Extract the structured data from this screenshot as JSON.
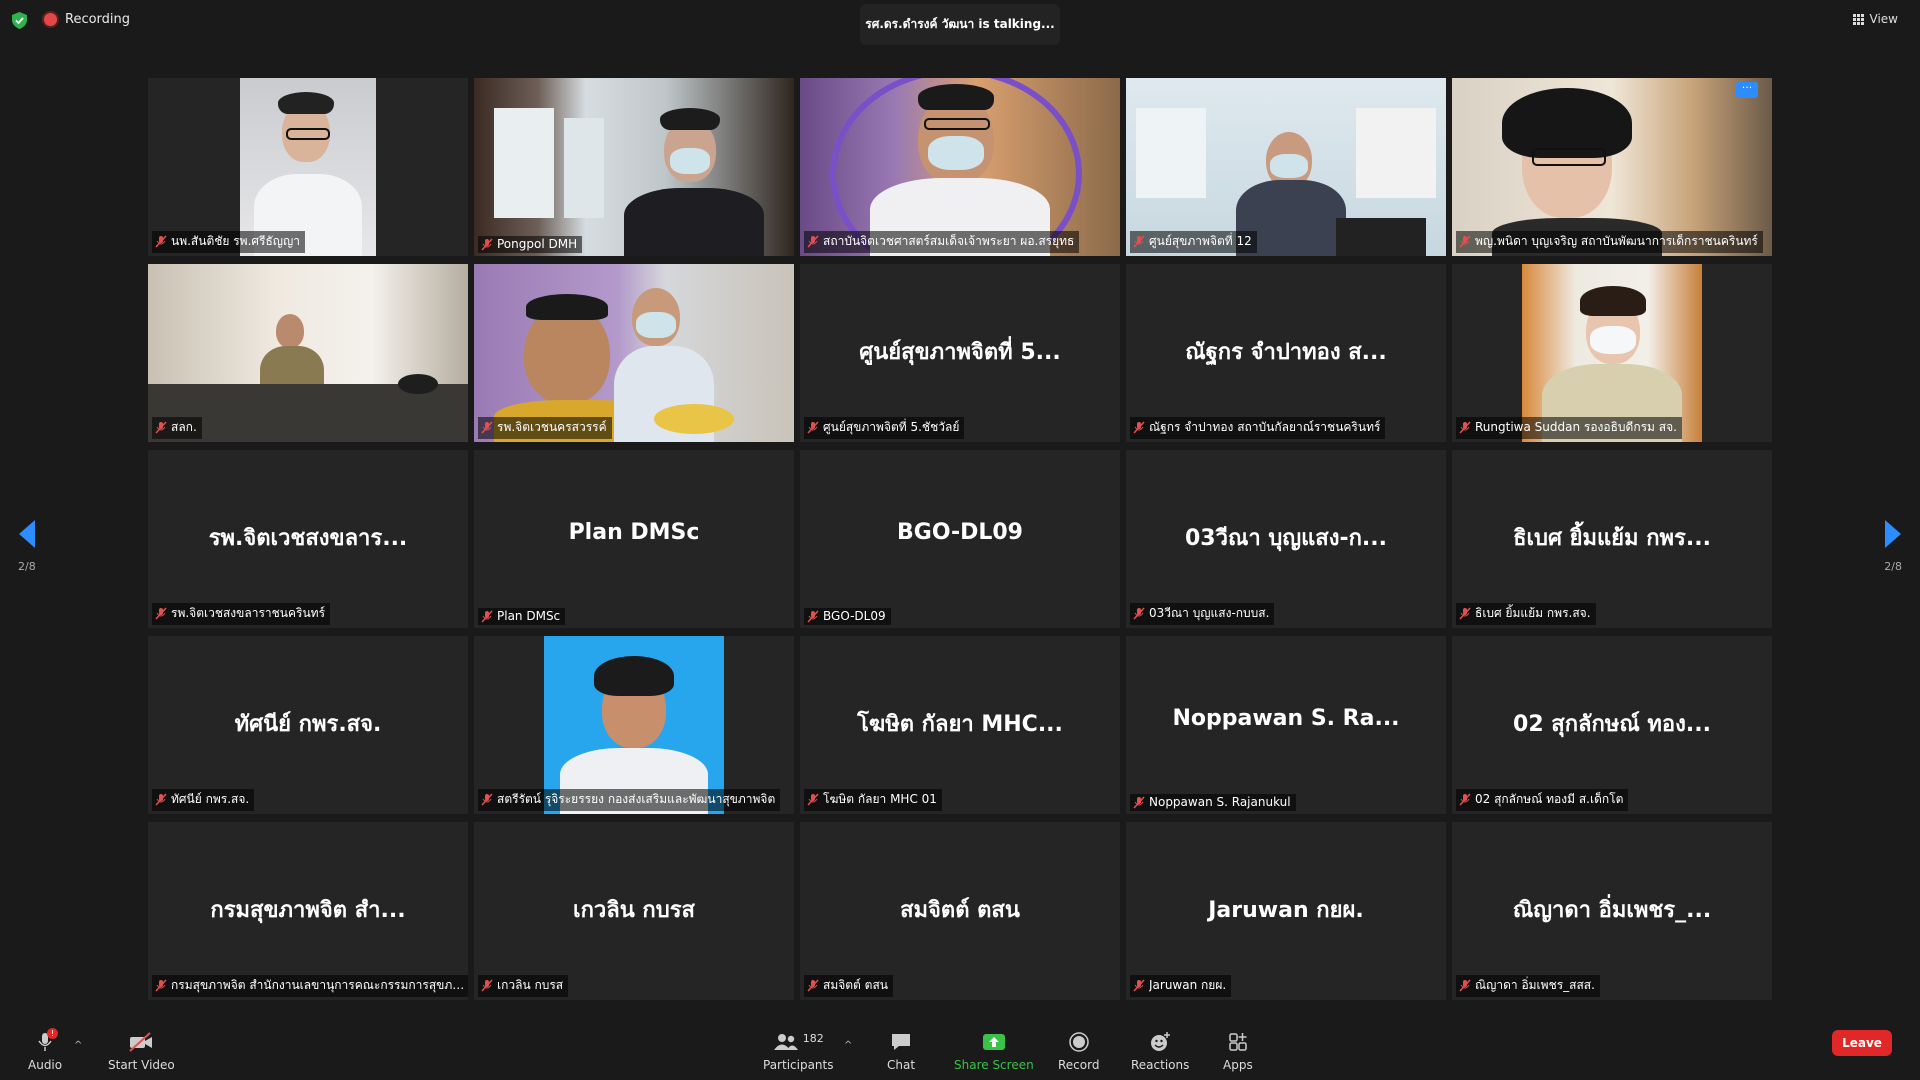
{
  "status": {
    "recording_label": "Recording",
    "talking": "รศ.ดร.ดำรงค์ วัฒนา is talking..."
  },
  "view_label": "View",
  "paging": {
    "left": "2/8",
    "right": "2/8"
  },
  "tiles": [
    {
      "display": "",
      "name": "นพ.สันติชัย รพ.ศรีธัญญา"
    },
    {
      "display": "",
      "name": "Pongpol DMH"
    },
    {
      "display": "",
      "name": "สถาบันจิตเวชศาสตร์สมเด็จเจ้าพระยา ผอ.สรยุทธ"
    },
    {
      "display": "",
      "name": "ศูนย์สุขภาพจิตที่ 12"
    },
    {
      "display": "",
      "name": "พญ.พนิดา บุญเจริญ สถาบันพัฒนาการเด็กราชนครินทร์"
    },
    {
      "display": "",
      "name": "สลก."
    },
    {
      "display": "",
      "name": "รพ.จิตเวชนครสวรรค์"
    },
    {
      "display": "ศูนย์สุขภาพจิตที่ 5...",
      "name": "ศูนย์สุขภาพจิตที่ 5.ชัชวัลย์"
    },
    {
      "display": "ณัฐกร จำปาทอง ส...",
      "name": "ณัฐกร จำปาทอง สถาบันกัลยาณ์ราชนครินทร์"
    },
    {
      "display": "",
      "name": "Rungtiwa Suddan รองอธิบดีกรม สจ."
    },
    {
      "display": "รพ.จิตเวชสงขลาร...",
      "name": "รพ.จิตเวชสงขลาราชนครินทร์"
    },
    {
      "display": "Plan DMSc",
      "name": "Plan DMSc"
    },
    {
      "display": "BGO-DL09",
      "name": "BGO-DL09"
    },
    {
      "display": "03วีณา บุญแสง-ก...",
      "name": "03วีณา บุญแสง-กบบส."
    },
    {
      "display": "ธิเบศ ยิ้มแย้ม กพร...",
      "name": "ธิเบศ ยิ้มแย้ม กพร.สจ."
    },
    {
      "display": "ทัศนีย์ กพร.สจ.",
      "name": "ทัศนีย์ กพร.สจ."
    },
    {
      "display": "",
      "name": "สตรีรัตน์ รุจิระยรรยง กองส่งเสริมและพัฒนาสุขภาพจิต"
    },
    {
      "display": "โฆษิต กัลยา MHC...",
      "name": "โฆษิต กัลยา MHC 01"
    },
    {
      "display": "Noppawan S. Ra...",
      "name": "Noppawan S. Rajanukul"
    },
    {
      "display": "02 สุกลักษณ์ ทอง...",
      "name": "02 สุกลักษณ์ ทองมี ส.เด็กโต"
    },
    {
      "display": "กรมสุขภาพจิต สำ...",
      "name": "กรมสุขภาพจิต สำนักงานเลขานุการคณะกรรมการสุขภาพ..."
    },
    {
      "display": "เกวลิน กบรส",
      "name": "เกวลิน กบรส"
    },
    {
      "display": "สมจิตต์ ตสน",
      "name": "สมจิตต์ ตสน"
    },
    {
      "display": "Jaruwan กยผ.",
      "name": "Jaruwan กยผ."
    },
    {
      "display": "ณิญาดา อิ่มเพชร_...",
      "name": "ณิญาดา อิ่มเพชร_สสส."
    }
  ],
  "toolbar": {
    "audio": "Audio",
    "audio_badge": "!",
    "video": "Start Video",
    "participants": "Participants",
    "participants_count": "182",
    "chat": "Chat",
    "share": "Share Screen",
    "record": "Record",
    "reactions": "Reactions",
    "apps": "Apps",
    "leave": "Leave"
  },
  "colors": {
    "accent": "#2d8cff",
    "leave": "#e02828",
    "share": "#3bc14a",
    "recording": "#e34848"
  }
}
